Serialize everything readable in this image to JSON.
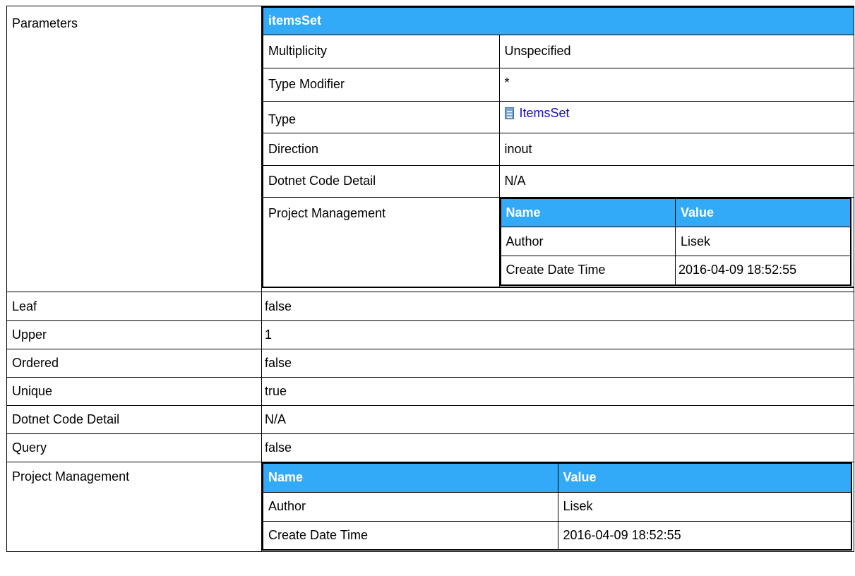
{
  "main": {
    "parameters_label": "Parameters",
    "param": {
      "name": "itemsSet",
      "rows": [
        {
          "label": "Multiplicity",
          "value": "Unspecified"
        },
        {
          "label": "Type Modifier",
          "value": "*"
        },
        {
          "label": "Type",
          "value": "ItemsSet",
          "icon": "class-doc-icon"
        },
        {
          "label": "Direction",
          "value": "inout"
        },
        {
          "label": "Dotnet Code Detail",
          "value": "N/A"
        }
      ],
      "pm": {
        "label": "Project Management",
        "header": {
          "name": "Name",
          "value": "Value"
        },
        "rows": [
          {
            "name": "Author",
            "value": "Lisek"
          },
          {
            "name": "Create Date Time",
            "value": "2016-04-09 18:52:55"
          }
        ]
      }
    },
    "rows": [
      {
        "label": "Leaf",
        "value": "false"
      },
      {
        "label": "Upper",
        "value": "1"
      },
      {
        "label": "Ordered",
        "value": "false"
      },
      {
        "label": "Unique",
        "value": "true"
      },
      {
        "label": "Dotnet Code Detail",
        "value": "N/A"
      },
      {
        "label": "Query",
        "value": "false"
      }
    ],
    "pm": {
      "label": "Project Management",
      "header": {
        "name": "Name",
        "value": "Value"
      },
      "rows": [
        {
          "name": "Author",
          "value": "Lisek"
        },
        {
          "name": "Create Date Time",
          "value": "2016-04-09 18:52:55"
        }
      ]
    }
  },
  "colors": {
    "header_bg": "#33aaf7",
    "link": "#1a0dcc"
  }
}
